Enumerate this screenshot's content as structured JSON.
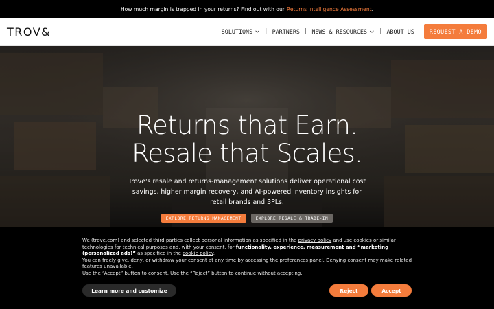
{
  "announcement": {
    "text": "How much margin is trapped in your returns? Find out with our",
    "link": "Returns Intelligence Assessment",
    "suffix": "."
  },
  "header": {
    "logo": "TROV&",
    "nav": [
      {
        "label": "SOLUTIONS",
        "has_dropdown": true
      },
      {
        "label": "PARTNERS",
        "has_dropdown": false
      },
      {
        "label": "NEWS & RESOURCES",
        "has_dropdown": true
      },
      {
        "label": "ABOUT US",
        "has_dropdown": false
      }
    ],
    "separator": "|",
    "cta": "REQUEST A DEMO"
  },
  "hero": {
    "title_line1": "Returns that Earn.",
    "title_line2": "Resale that Scales.",
    "subtitle": "Trove's resale and returns-management solutions deliver operational cost savings, higher margin recovery, and AI-powered inventory insights for retail brands and 3PLs.",
    "button_primary": "EXPLORE RETURNS MANAGEMENT",
    "button_secondary": "EXPLORE RESALE & TRADE-IN"
  },
  "cookie": {
    "p1_a": "We (trove.com) and selected third parties collect personal information as specified in the ",
    "p1_link1": "privacy policy",
    "p1_b": " and use cookies or similar technologies for technical purposes and, with your consent, for ",
    "p1_bold": "functionality, experience, measurement and “marketing (personalized ads)”",
    "p1_c": " as specified in the ",
    "p1_link2": "cookie policy",
    "p1_d": ".",
    "p2": "You can freely give, deny, or withdraw your consent at any time by accessing the preferences panel. Denying consent may make related features unavailable.",
    "p3": "Use the “Accept” button to consent. Use the “Reject” button to continue without accepting.",
    "btn_learn": "Learn more and customize",
    "btn_reject": "Reject",
    "btn_accept": "Accept"
  },
  "colors": {
    "accent": "#f47c3c",
    "banner_bg": "#000000",
    "header_bg": "#ffffff"
  }
}
